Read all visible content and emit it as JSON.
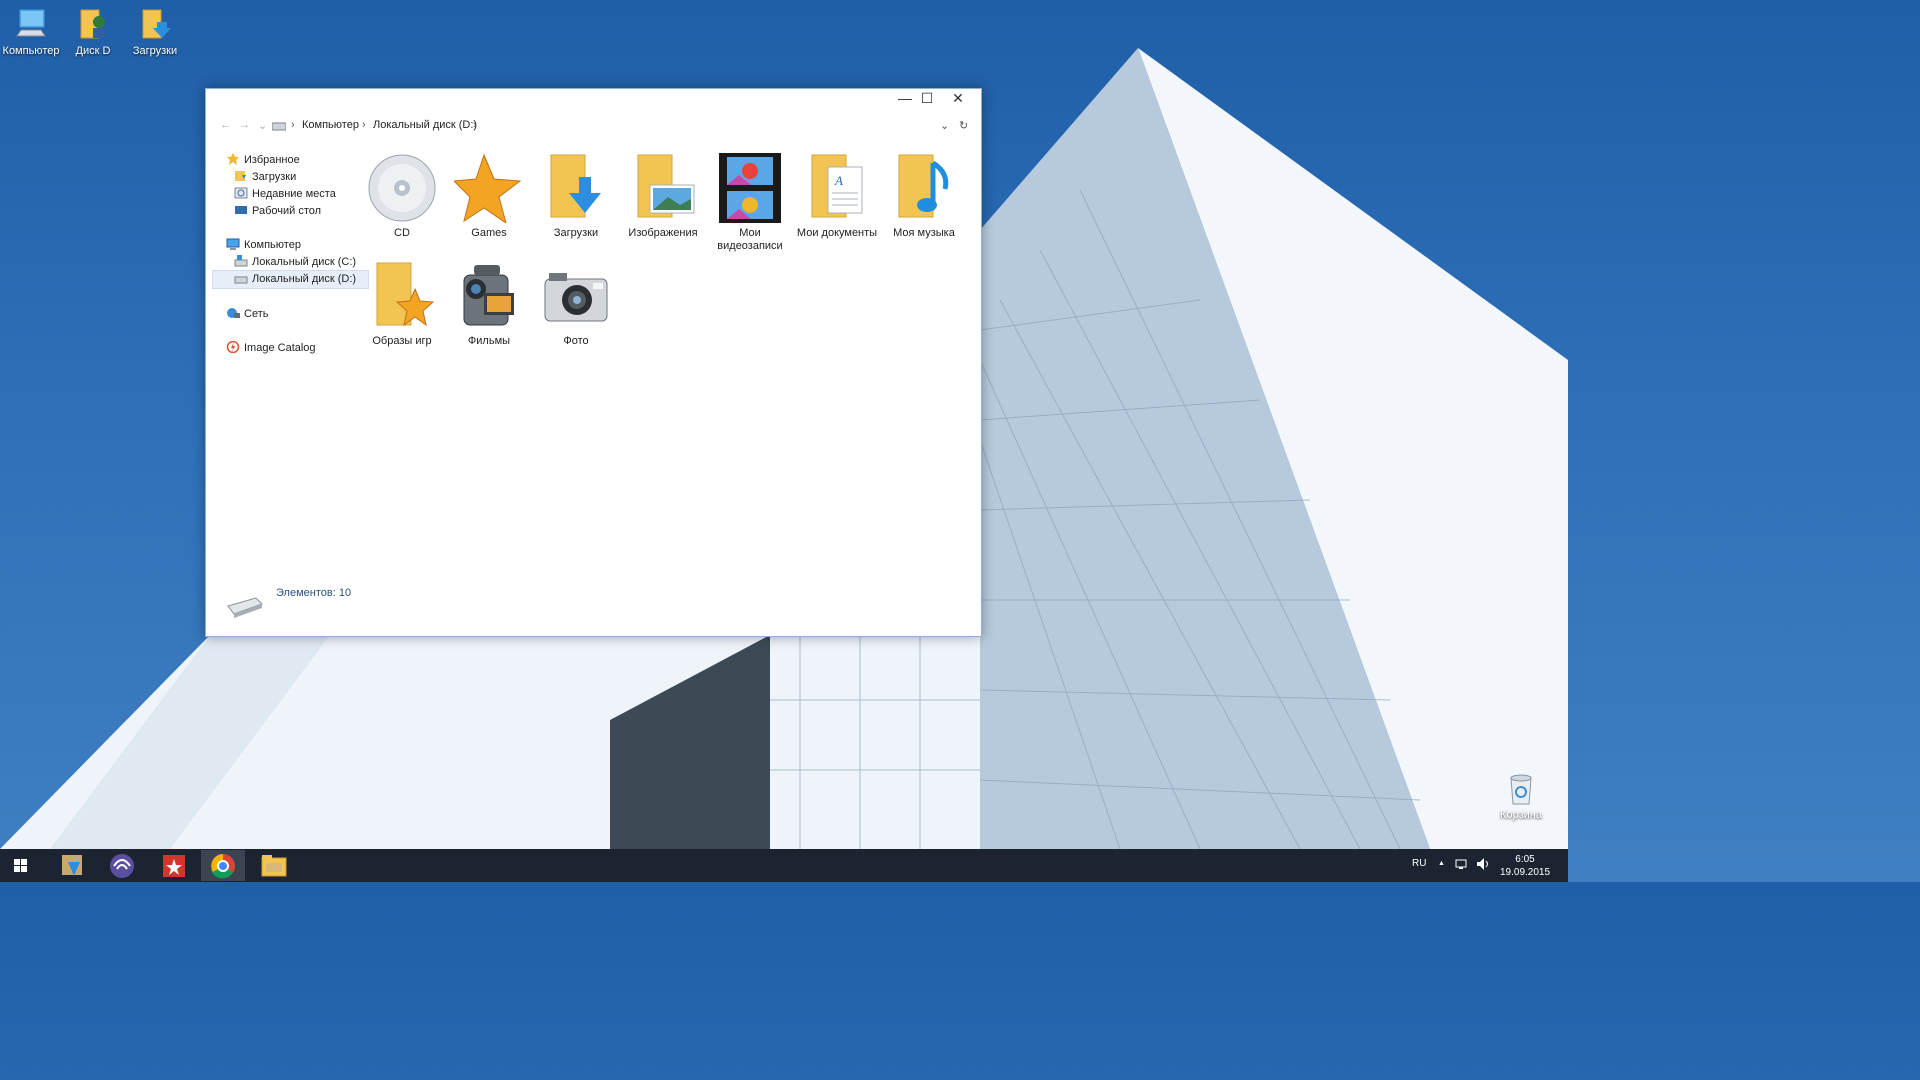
{
  "desktop": {
    "icons": [
      {
        "label": "Компьютер",
        "icon": "computer-icon"
      },
      {
        "label": "Диск D",
        "icon": "user-folder-icon"
      },
      {
        "label": "Загрузки",
        "icon": "downloads-folder-icon"
      },
      {
        "label": "Корзина",
        "icon": "recycle-bin-icon"
      }
    ]
  },
  "explorer": {
    "controls": {
      "minimize": "—",
      "maximize": "☐",
      "close": "✕"
    },
    "address": {
      "back": "←",
      "forward": "→",
      "dropdown": "⌄",
      "refresh": "↻",
      "crumbs": [
        "Компьютер",
        "Локальный диск (D:)"
      ],
      "sep": "›"
    },
    "nav": {
      "favorites": "Избранное",
      "downloads": "Загрузки",
      "recent": "Недавние места",
      "desktop": "Рабочий стол",
      "computer": "Компьютер",
      "disk_c": "Локальный диск (C:)",
      "disk_d": "Локальный диск (D:)",
      "network": "Сеть",
      "image_catalog": "Image Catalog"
    },
    "items": [
      {
        "label": "CD",
        "icon": "cd-icon"
      },
      {
        "label": "Games",
        "icon": "star-icon"
      },
      {
        "label": "Загрузки",
        "icon": "downloads-folder-icon"
      },
      {
        "label": "Изображения",
        "icon": "pictures-folder-icon"
      },
      {
        "label": "Мои видеозаписи",
        "icon": "video-film-icon"
      },
      {
        "label": "Мои документы",
        "icon": "documents-folder-icon"
      },
      {
        "label": "Моя музыка",
        "icon": "music-folder-icon"
      },
      {
        "label": "Образы игр",
        "icon": "star-folder-icon"
      },
      {
        "label": "Фильмы",
        "icon": "camcorder-icon"
      },
      {
        "label": "Фото",
        "icon": "camera-icon"
      }
    ],
    "status": "Элементов: 10"
  },
  "taskbar": {
    "language": "RU",
    "time": "6:05",
    "date": "19.09.2015",
    "tray_chevron": "▲"
  },
  "colors": {
    "sky": "#2e6fb8",
    "taskbar": "#1b2430",
    "folder": "#f2c552",
    "window_border": "#8fb0d6"
  }
}
